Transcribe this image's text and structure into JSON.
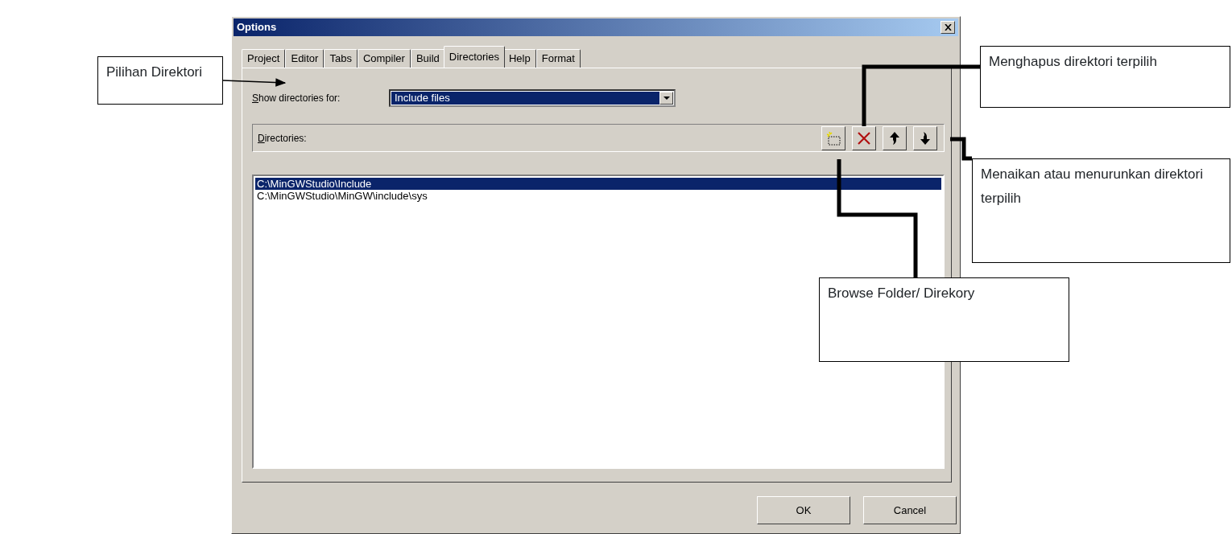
{
  "window": {
    "title": "Options"
  },
  "tabs": [
    {
      "label": "Project",
      "selected": false
    },
    {
      "label": "Editor",
      "selected": false
    },
    {
      "label": "Tabs",
      "selected": false
    },
    {
      "label": "Compiler",
      "selected": false
    },
    {
      "label": "Build",
      "selected": false
    },
    {
      "label": "Directories",
      "selected": true
    },
    {
      "label": "Help",
      "selected": false
    },
    {
      "label": "Format",
      "selected": false
    }
  ],
  "show_for": {
    "label": "Show directories for:",
    "mnemonic": true,
    "value": "Include files"
  },
  "directories": {
    "label": "Directories:",
    "mnemonic": true,
    "tools": [
      {
        "kind": "new"
      },
      {
        "kind": "delete"
      },
      {
        "kind": "up"
      },
      {
        "kind": "down"
      }
    ],
    "items": [
      {
        "text": "C:\\MinGWStudio\\Include",
        "selected": true
      },
      {
        "text": "C:\\MinGWStudio\\MinGW\\include\\sys",
        "selected": false
      }
    ]
  },
  "buttons": [
    "OK",
    "Cancel"
  ],
  "annotations": [
    {
      "text": "Pilihan Direktori",
      "kind": "combo"
    },
    {
      "text": "Menghapus direktori terpilih",
      "kind": "delete"
    },
    {
      "text": "Menaikan atau menurunkan direktori terpilih",
      "kind": "updown"
    },
    {
      "text": "Browse Folder/ Direkory",
      "kind": "new"
    }
  ]
}
